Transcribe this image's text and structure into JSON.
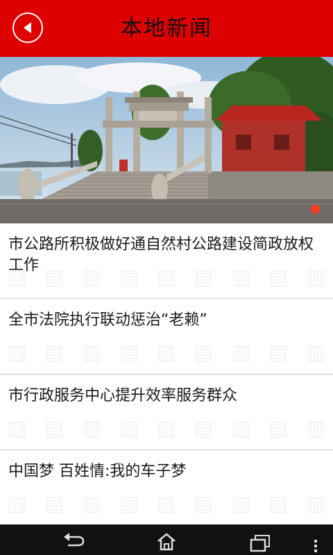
{
  "header": {
    "title": "本地新闻",
    "back_icon": "back-arrow-icon",
    "color": "#de0000"
  },
  "banner": {
    "slides": 1,
    "active_slide": 1,
    "indicator_color": "#ff3b22"
  },
  "news": [
    {
      "title": "市公路所积极做好通自然村公路建设简政放权工作"
    },
    {
      "title": "全市法院执行联动惩治“老赖”"
    },
    {
      "title": "市行政服务中心提升效率服务群众"
    },
    {
      "title": "中国梦 百姓情:我的车子梦"
    }
  ],
  "navbar": {
    "back_icon": "system-back-icon",
    "home_icon": "system-home-icon",
    "recents_icon": "system-recents-icon",
    "menu_icon": "system-menu-icon"
  }
}
